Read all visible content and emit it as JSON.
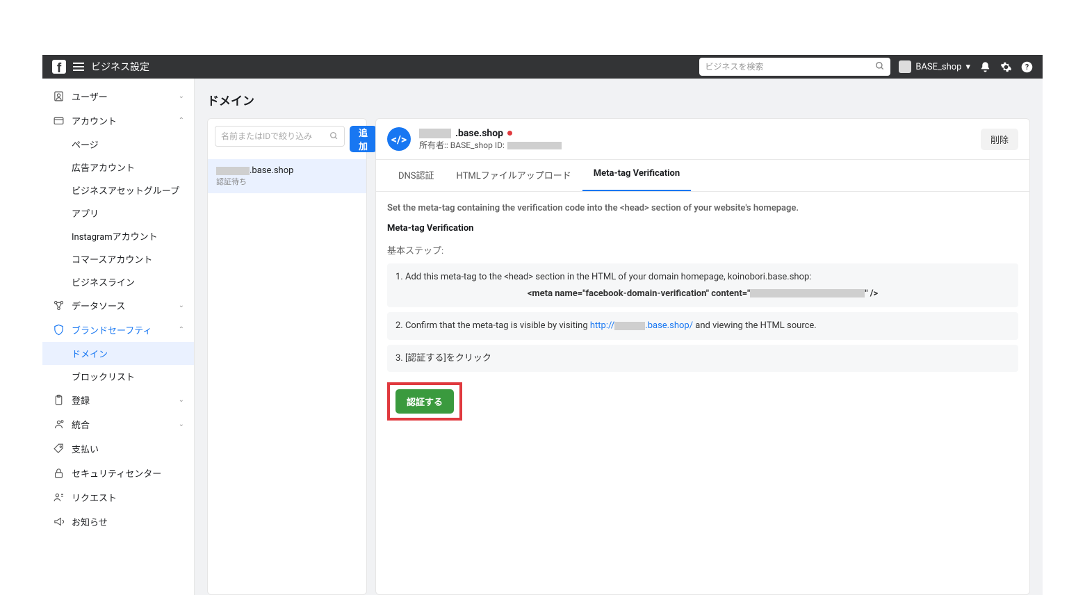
{
  "topbar": {
    "title": "ビジネス設定",
    "search_placeholder": "ビジネスを検索",
    "account_name": "BASE_shop"
  },
  "sidebar": {
    "users": "ユーザー",
    "accounts": "アカウント",
    "acc_children": [
      "ページ",
      "広告アカウント",
      "ビジネスアセットグループ",
      "アプリ",
      "Instagramアカウント",
      "コマースアカウント",
      "ビジネスライン"
    ],
    "data_sources": "データソース",
    "brand_safety": "ブランドセーフティ",
    "bs_children": [
      "ドメイン",
      "ブロックリスト"
    ],
    "register": "登録",
    "integration": "統合",
    "payment": "支払い",
    "security": "セキュリティセンター",
    "requests": "リクエスト",
    "news": "お知らせ"
  },
  "main": {
    "title": "ドメイン",
    "filter_placeholder": "名前またはIDで絞り込み",
    "add_label": "追加",
    "domain_list": {
      "suffix": ".base.shop",
      "status": "認証待ち"
    }
  },
  "detail": {
    "domain_suffix": ".base.shop",
    "owner_prefix": "所有者:: BASE_shop  ID:",
    "delete_label": "削除",
    "tabs": [
      "DNS認証",
      "HTMLファイルアップロード",
      "Meta-tag Verification"
    ],
    "desc": "Set the meta-tag containing the verification code into the <head> section of your website's homepage.",
    "heading": "Meta-tag Verification",
    "steps_label": "基本ステップ:",
    "step1_text": "1. Add this meta-tag to the <head> section in the HTML of your domain homepage, koinobori.base.shop:",
    "step1_meta_pre": "<meta name=\"facebook-domain-verification\" content=\"",
    "step1_meta_post": "\" />",
    "step2_pre": "2. Confirm that the meta-tag is visible by visiting ",
    "step2_link_pre": "http://",
    "step2_link_post": ".base.shop/",
    "step2_after": " and viewing the HTML source.",
    "step3": "3. [認証する]をクリック",
    "verify_label": "認証する"
  }
}
